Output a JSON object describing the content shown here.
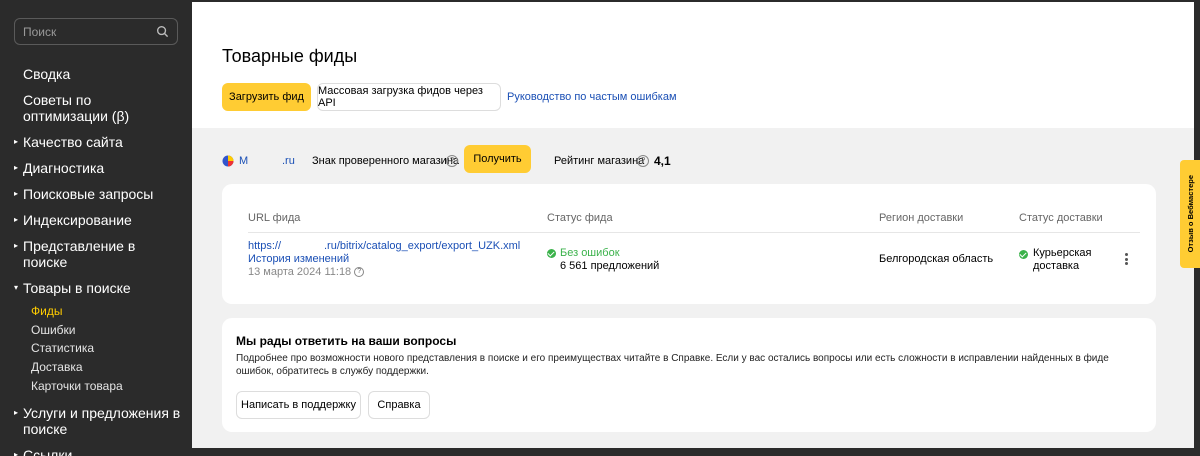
{
  "sidebar": {
    "search_placeholder": "Поиск",
    "items": [
      {
        "label": "Сводка",
        "arrow": false
      },
      {
        "label": "Советы по оптимизации (β)",
        "arrow": false
      },
      {
        "label": "Качество сайта",
        "arrow": true
      },
      {
        "label": "Диагностика",
        "arrow": true
      },
      {
        "label": "Поисковые запросы",
        "arrow": true
      },
      {
        "label": "Индексирование",
        "arrow": true
      },
      {
        "label": "Представление в поиске",
        "arrow": true
      },
      {
        "label": "Товары в поиске",
        "arrow": true,
        "expanded": true
      },
      {
        "label": "Услуги и предложения в поиске",
        "arrow": true
      },
      {
        "label": "Ссылки",
        "arrow": true
      }
    ],
    "subitems": [
      "Фиды",
      "Ошибки",
      "Статистика",
      "Доставка",
      "Карточки товара"
    ],
    "active_subitem": "Фиды"
  },
  "header": {
    "title": "Товарные фиды",
    "upload_button": "Загрузить фид",
    "api_button": "Массовая загрузка фидов через API",
    "errors_guide_link": "Руководство по частым ошибкам"
  },
  "store": {
    "name_start": "М",
    "name_end": ".ru",
    "verified_label": "Знак проверенного магазина",
    "get_button": "Получить",
    "rating_label": "Рейтинг магазина",
    "rating_value": "4,1"
  },
  "feeds_table": {
    "headers": [
      "URL фида",
      "Статус фида",
      "Регион доставки",
      "Статус доставки"
    ],
    "rows": [
      {
        "url_start": "https://",
        "url_end": ".ru/bitrix/catalog_export/export_UZK.xml",
        "history_link": "История изменений",
        "date": "13 марта 2024 11:18",
        "status": "Без ошибок",
        "offers": "6 561 предложений",
        "region": "Белгородская область",
        "delivery_status": "Курьерская доставка"
      }
    ]
  },
  "help": {
    "title": "Мы рады ответить на ваши вопросы",
    "text": "Подробнее про возможности нового представления в поиске и его преимуществах читайте в Справке. Если у вас остались вопросы или есть сложности в исправлении найденных в фиде ошибок, обратитесь в службу поддержки.",
    "support_button": "Написать в поддержку",
    "help_button": "Справка"
  },
  "feedback_tab": "Отзыв о Вебмастере",
  "colors": {
    "accent": "#ffcc33",
    "active_nav": "#ffcc00",
    "link": "#1a4fb5",
    "success": "#3bb24b",
    "sidebar_bg": "#2b2b2b",
    "main_bg": "#f1f1f1"
  }
}
